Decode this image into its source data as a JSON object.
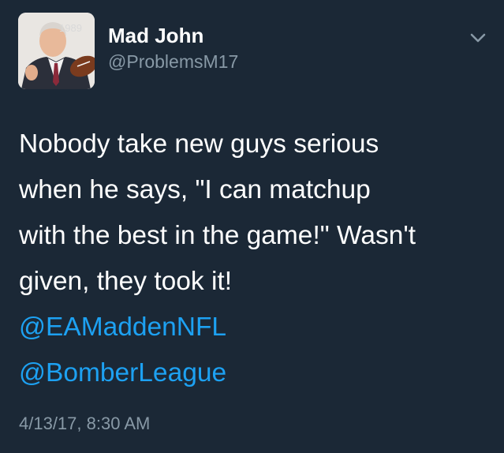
{
  "author": {
    "display_name": "Mad John",
    "handle": "@ProblemsM17",
    "avatar_badge_text": "1989"
  },
  "tweet": {
    "lines": [
      "Nobody take new guys serious",
      "when he says, \"I can matchup",
      "with the best in the game!\" Wasn't",
      "given, they took it!"
    ],
    "mentions": [
      "@EAMaddenNFL",
      "@BomberLeague"
    ],
    "timestamp": "4/13/17, 8:30 AM"
  },
  "icons": {
    "menu": "chevron-down-icon"
  },
  "colors": {
    "background": "#1b2836",
    "text": "#ffffff",
    "secondary_text": "#8899a6",
    "link": "#1da1f2"
  }
}
